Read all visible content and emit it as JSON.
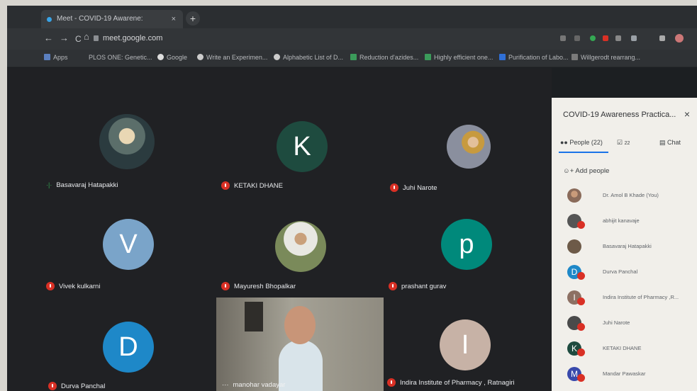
{
  "browser": {
    "tab_title": "Meet - COVID-19 Awarene:",
    "tab_close": "×",
    "new_tab": "+",
    "nav_back": "←",
    "nav_forward": "→",
    "nav_reload": "C",
    "nav_home": "⌂",
    "url": "meet.google.com",
    "bookmarks": [
      "Apps",
      "PLOS ONE: Genetic...",
      "Google",
      "Write an Experimen...",
      "Alphabetic List of D...",
      "Reduction d'azides...",
      "Highly efficient one...",
      "Purification of Labo...",
      "Willgerodt rearrang..."
    ]
  },
  "grid": {
    "tiles": [
      {
        "name": "Basavaraj Hatapakki",
        "status": "speaking"
      },
      {
        "name": "KETAKI DHANE",
        "initial": "K",
        "status": "muted"
      },
      {
        "name": "Juhi Narote",
        "status": "muted"
      },
      {
        "name": "Vivek kulkarni",
        "initial": "V",
        "status": "muted"
      },
      {
        "name": "Mayuresh Bhopalkar",
        "status": "muted"
      },
      {
        "name": "prashant gurav",
        "initial": "p",
        "status": "muted"
      },
      {
        "name": "Durva Panchal",
        "initial": "D",
        "status": "muted"
      },
      {
        "name": "manohar vadayar",
        "status": "video"
      },
      {
        "name": "Indira Institute of Pharmacy , Ratnagiri",
        "initial": "I",
        "status": "muted"
      }
    ],
    "colors": {
      "K": "#1e4b3f",
      "V": "#7aa4c9",
      "p": "#00897b",
      "D": "#1e88c8",
      "I": "#c7b2a6"
    }
  },
  "panel": {
    "title": "COVID-19 Awareness Practica...",
    "close": "×",
    "tabs": {
      "people": "People (22)",
      "tasks": "22",
      "chat": "Chat"
    },
    "add_people": "Add people",
    "participants": [
      {
        "name": "Dr. Amol B Khade (You)",
        "avatar": "photo"
      },
      {
        "name": "abhijit kanavaje",
        "avatar": "photo"
      },
      {
        "name": "Basavaraj Hatapakki",
        "avatar": "photo"
      },
      {
        "name": "Durva Panchal",
        "avatar": "D"
      },
      {
        "name": "Indira Institute of Pharmacy ,R...",
        "avatar": "I"
      },
      {
        "name": "Juhi Narote",
        "avatar": "photo"
      },
      {
        "name": "KETAKI DHANE",
        "avatar": "K"
      },
      {
        "name": "Mandar Pawaskar",
        "avatar": "M"
      }
    ]
  }
}
